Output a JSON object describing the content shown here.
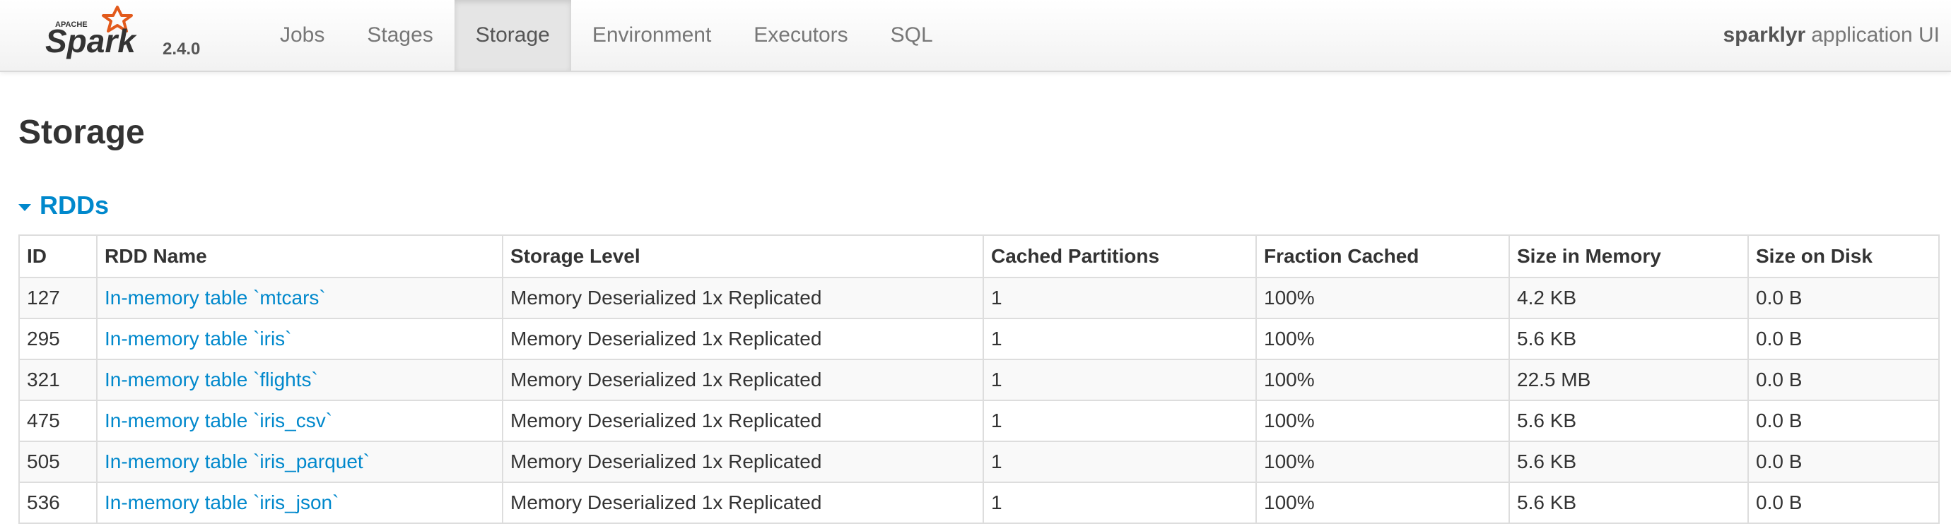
{
  "brand": {
    "logo_word": "Spark",
    "logo_super": "APACHE",
    "version": "2.4.0",
    "logo_color": "#e25a1c"
  },
  "nav": {
    "tabs": [
      {
        "label": "Jobs",
        "active": false
      },
      {
        "label": "Stages",
        "active": false
      },
      {
        "label": "Storage",
        "active": true
      },
      {
        "label": "Environment",
        "active": false
      },
      {
        "label": "Executors",
        "active": false
      },
      {
        "label": "SQL",
        "active": false
      }
    ],
    "app_name_bold": "sparklyr",
    "app_name_rest": "application UI"
  },
  "page": {
    "title": "Storage",
    "section_label": "RDDs",
    "accent_color": "#0088cc"
  },
  "table": {
    "headers": [
      "ID",
      "RDD Name",
      "Storage Level",
      "Cached Partitions",
      "Fraction Cached",
      "Size in Memory",
      "Size on Disk"
    ],
    "rows": [
      [
        "127",
        "In-memory table `mtcars`",
        "Memory Deserialized 1x Replicated",
        "1",
        "100%",
        "4.2 KB",
        "0.0 B"
      ],
      [
        "295",
        "In-memory table `iris`",
        "Memory Deserialized 1x Replicated",
        "1",
        "100%",
        "5.6 KB",
        "0.0 B"
      ],
      [
        "321",
        "In-memory table `flights`",
        "Memory Deserialized 1x Replicated",
        "1",
        "100%",
        "22.5 MB",
        "0.0 B"
      ],
      [
        "475",
        "In-memory table `iris_csv`",
        "Memory Deserialized 1x Replicated",
        "1",
        "100%",
        "5.6 KB",
        "0.0 B"
      ],
      [
        "505",
        "In-memory table `iris_parquet`",
        "Memory Deserialized 1x Replicated",
        "1",
        "100%",
        "5.6 KB",
        "0.0 B"
      ],
      [
        "536",
        "In-memory table `iris_json`",
        "Memory Deserialized 1x Replicated",
        "1",
        "100%",
        "5.6 KB",
        "0.0 B"
      ]
    ]
  }
}
